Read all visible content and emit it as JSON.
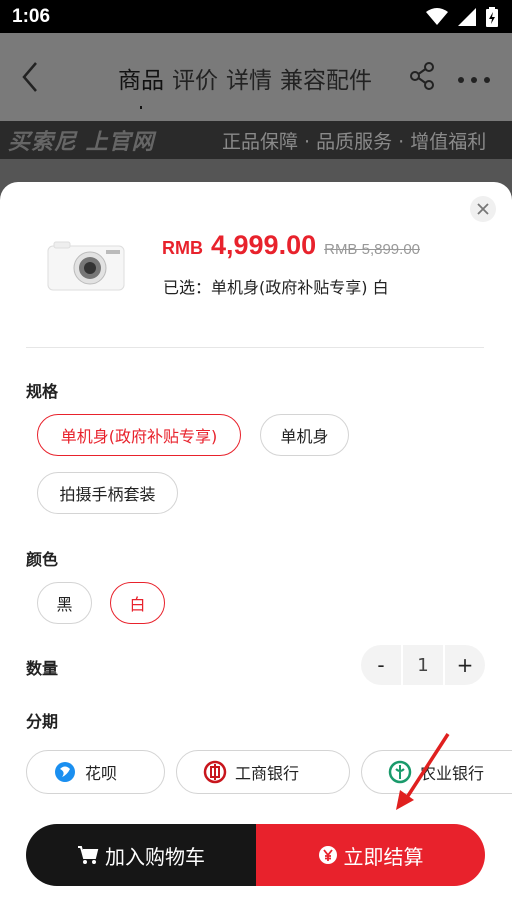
{
  "status_bar": {
    "time": "1:06"
  },
  "header": {
    "tabs": [
      {
        "label": "商品",
        "active": true
      },
      {
        "label": "评价",
        "active": false
      },
      {
        "label": "详情",
        "active": false
      },
      {
        "label": "兼容配件",
        "active": false
      }
    ]
  },
  "banner": {
    "logo": "买索尼 上官网",
    "slogan": "正品保障 · 品质服务 · 增值福利"
  },
  "product": {
    "currency": "RMB",
    "price": "4,999.00",
    "original_price": "RMB 5,899.00",
    "selected": "已选：单机身(政府补贴专享) 白"
  },
  "spec": {
    "title": "规格",
    "options": [
      {
        "label": "单机身(政府补贴专享)",
        "selected": true
      },
      {
        "label": "单机身",
        "selected": false
      },
      {
        "label": "拍摄手柄套装",
        "selected": false
      }
    ]
  },
  "color": {
    "title": "颜色",
    "options": [
      {
        "label": "黑",
        "selected": false
      },
      {
        "label": "白",
        "selected": true
      }
    ]
  },
  "quantity": {
    "title": "数量",
    "minus": "-",
    "value": "1",
    "plus": "+"
  },
  "installment": {
    "title": "分期",
    "options": [
      {
        "label": "花呗",
        "icon": "huabei-icon"
      },
      {
        "label": "工商银行",
        "icon": "icbc-icon"
      },
      {
        "label": "农业银行",
        "icon": "abc-bank-icon"
      }
    ]
  },
  "actions": {
    "add_to_cart": "加入购物车",
    "buy_now": "立即结算"
  },
  "colors": {
    "accent": "#e8222c",
    "dark": "#161616"
  }
}
